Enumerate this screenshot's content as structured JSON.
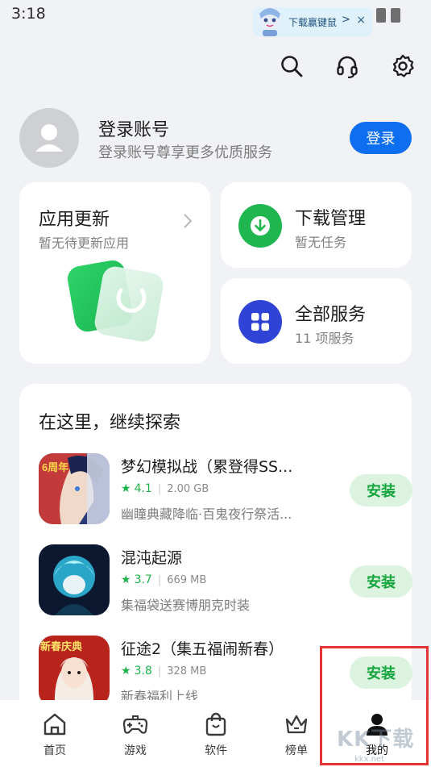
{
  "status_bar": {
    "time": "3:18"
  },
  "floating_banner": {
    "label": "下载赢键鼠",
    "chevron": ">",
    "close": "×"
  },
  "top_actions": {
    "icons": [
      "search-icon",
      "headset-icon",
      "settings-icon"
    ]
  },
  "account": {
    "title": "登录账号",
    "subtitle": "登录账号尊享更多优质服务",
    "login_button": "登录"
  },
  "cards": {
    "update": {
      "title": "应用更新",
      "subtitle": "暂无待更新应用"
    },
    "download": {
      "title": "下载管理",
      "subtitle": "暂无任务"
    },
    "services": {
      "title": "全部服务",
      "subtitle": "11 项服务"
    }
  },
  "explore": {
    "title": "在这里，继续探索",
    "apps": [
      {
        "name": "梦幻模拟战（累登得SS...",
        "rating": "4.1",
        "size": "2.00 GB",
        "description": "幽瞳典藏降临·百鬼夜行祭活...",
        "install": "安装",
        "icon_badge": "6周年"
      },
      {
        "name": "混沌起源",
        "rating": "3.7",
        "size": "669 MB",
        "description": "集福袋送赛博朋克时装",
        "install": "安装"
      },
      {
        "name": "征途2（集五福闹新春）",
        "rating": "3.8",
        "size": "328 MB",
        "description": "新春福利上线",
        "install": "安装",
        "icon_badge": "新春庆典"
      }
    ]
  },
  "bottom_nav": {
    "items": [
      {
        "label": "首页",
        "icon": "home-icon"
      },
      {
        "label": "游戏",
        "icon": "gamepad-icon"
      },
      {
        "label": "软件",
        "icon": "bag-icon"
      },
      {
        "label": "榜单",
        "icon": "crown-icon"
      },
      {
        "label": "我的",
        "icon": "person-icon",
        "active": true
      }
    ]
  },
  "watermark": {
    "text": "KK下载",
    "url": "kkx.net"
  },
  "colors": {
    "accent_blue": "#0e6ef0",
    "install_green": "#14a53d",
    "download_green": "#1fb650",
    "services_blue": "#2f44d6",
    "highlight_red": "#e53434"
  }
}
